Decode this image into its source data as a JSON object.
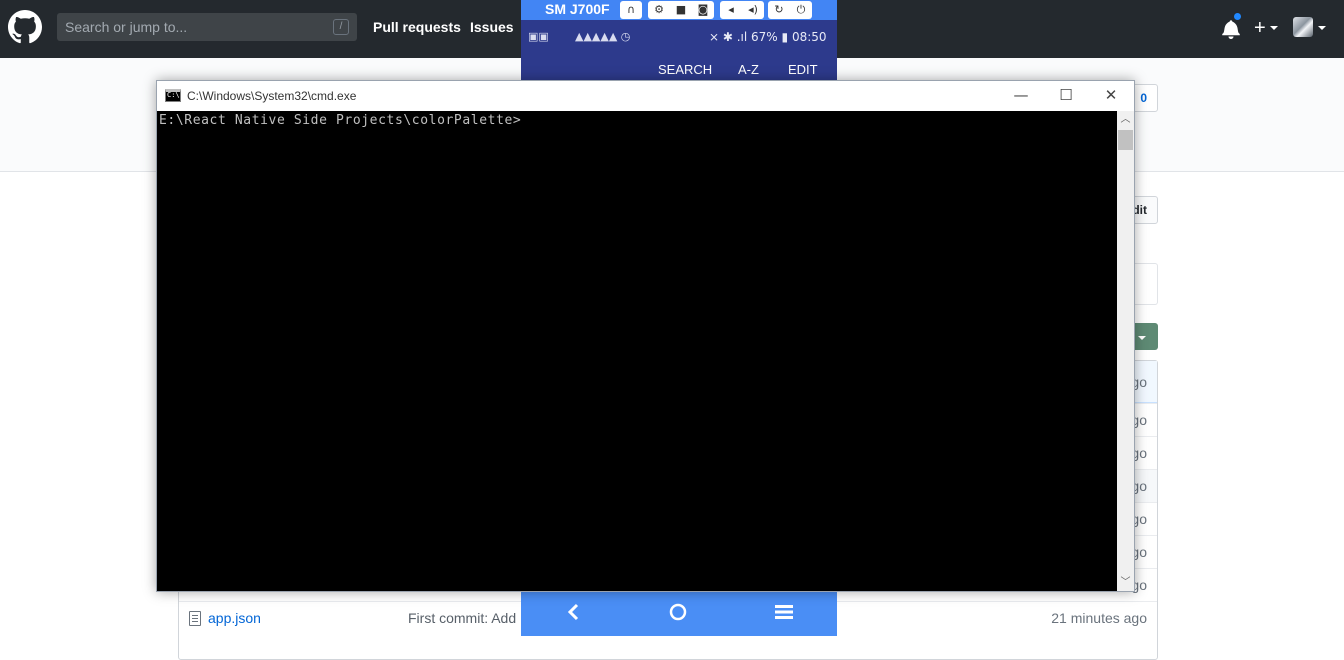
{
  "github": {
    "search_placeholder": "Search or jump to...",
    "search_shortcut": "/",
    "nav": [
      "Pull requests",
      "Issues"
    ],
    "plus": "+",
    "repo_count_fragment": "0",
    "edit_fragment": "dit",
    "rows": [
      {
        "name": "",
        "message": "",
        "time": "go"
      },
      {
        "name": "",
        "message": "",
        "time": "go"
      },
      {
        "name": "",
        "message": "",
        "time": "go"
      },
      {
        "name": "",
        "message": "",
        "time": "go"
      },
      {
        "name": "",
        "message": "",
        "time": "go"
      },
      {
        "name": "",
        "message": "",
        "time": "go"
      },
      {
        "name": "",
        "message": "",
        "time": "go"
      },
      {
        "name": "app.json",
        "message": "First commit: Add",
        "time": "21 minutes ago"
      }
    ]
  },
  "phone": {
    "device_name": "SM J700F",
    "toolbar_icons": [
      "headset-icon",
      "settings-icon",
      "video-icon",
      "camera-icon",
      "volume-down-icon",
      "volume-up-icon",
      "rotate-icon",
      "power-icon"
    ],
    "status_left_icons": "▣▣",
    "status_warnings": "▲▲▲▲▲ ◷",
    "status_right": "⨯ ✱ .ıl 67% ▮ 08:50",
    "battery": "67%",
    "clock": "08:50",
    "appbar": [
      "SEARCH",
      "A-Z",
      "EDIT"
    ],
    "nav_icons": [
      "back-icon",
      "home-icon",
      "recents-icon"
    ]
  },
  "cmd": {
    "title": "C:\\Windows\\System32\\cmd.exe",
    "icon_text": "C:\\",
    "prompt": "E:\\React Native Side Projects\\colorPalette>",
    "minimize": "—",
    "maximize": "☐",
    "close": "✕",
    "scroll_up": "︿",
    "scroll_down": "﹀"
  },
  "colors": {
    "github_header": "#24292e",
    "phone_accent": "#4285f4",
    "phone_status": "#2d3a8c",
    "console_bg": "#000000",
    "console_text": "#c0c0c0"
  }
}
